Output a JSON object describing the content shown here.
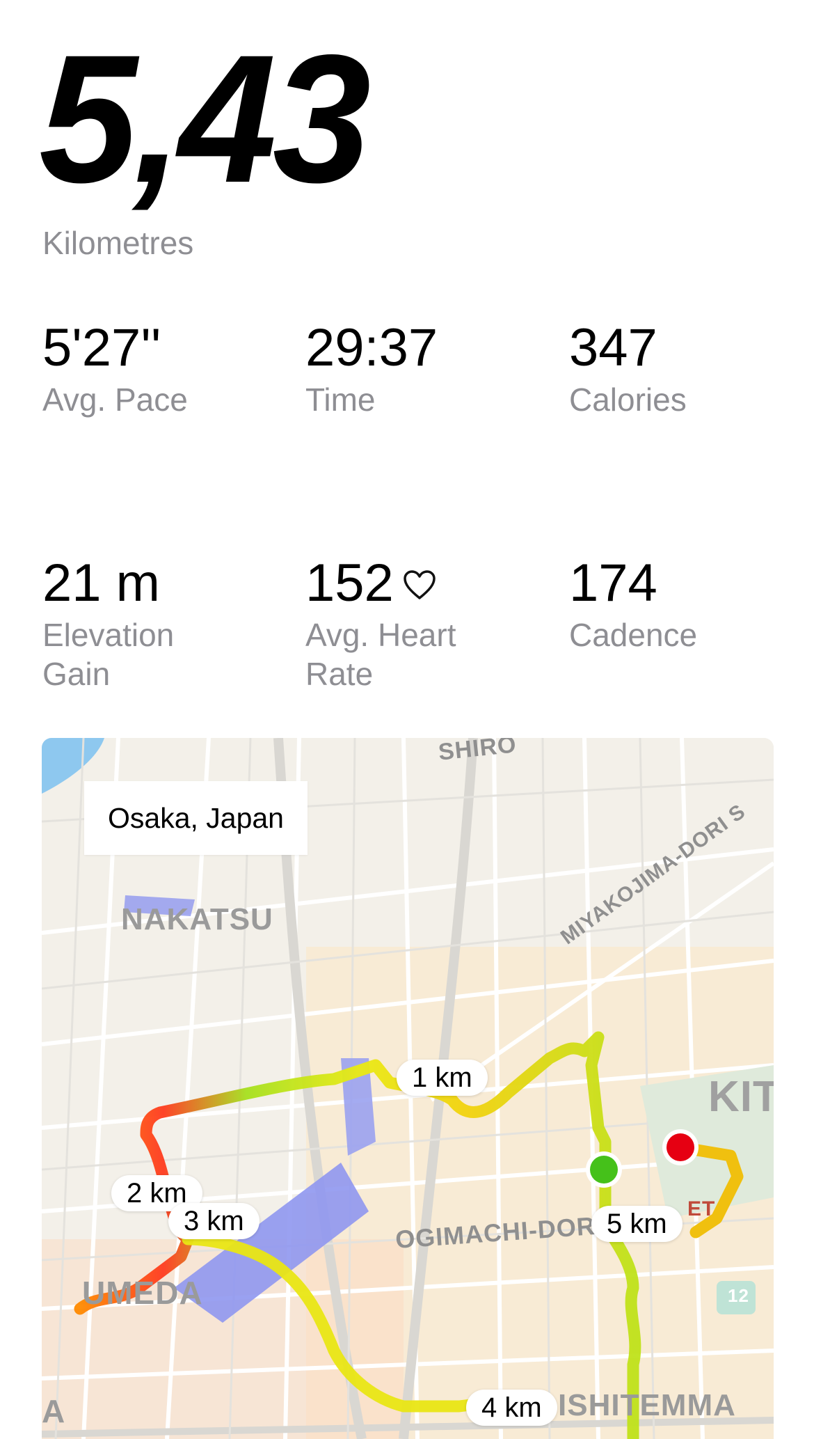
{
  "distance": {
    "value": "5,43",
    "unit": "Kilometres"
  },
  "stats": [
    {
      "value": "5'27''",
      "label": "Avg. Pace"
    },
    {
      "value": "29:37",
      "label": "Time"
    },
    {
      "value": "347",
      "label": "Calories"
    },
    {
      "value": "21 m",
      "label": "Elevation Gain"
    },
    {
      "value": "152",
      "label": "Avg. Heart Rate",
      "icon": "heart-icon"
    },
    {
      "value": "174",
      "label": "Cadence"
    }
  ],
  "map": {
    "location": "Osaka, Japan",
    "markers": [
      "1 km",
      "2 km",
      "3 km",
      "4 km",
      "5 km"
    ],
    "labels": {
      "nakatsu": "NAKATSU",
      "umeda": "UMEDA",
      "shiro": "SHIRO",
      "kita": "KIT",
      "miyakojima": "MIYAKOJIMA-DORI S",
      "ogimachi": "OGIMACHI-DOR",
      "tenma": "ISHITEMMA",
      "a": "A",
      "et": "ET",
      "route_num": "12"
    },
    "start_color": "#45c11a",
    "end_color": "#e60012"
  }
}
